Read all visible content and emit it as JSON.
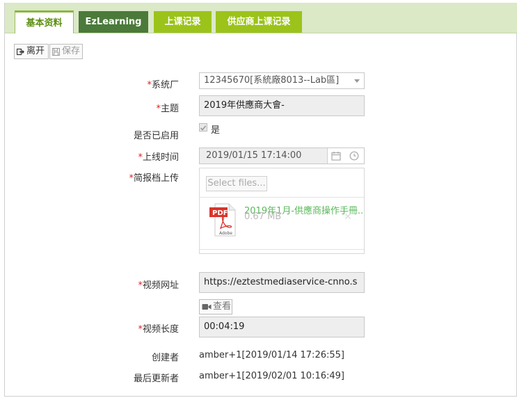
{
  "tabs": [
    "基本资料",
    "EzLearning",
    "上课记录",
    "供应商上课记录"
  ],
  "toolbar": {
    "leave_label": "离开",
    "save_label": "保存"
  },
  "form": {
    "required_mark": "*",
    "system_factory": {
      "label": "系统厂",
      "value": "12345670[系統廠8013--Lab區]"
    },
    "subject": {
      "label": "主题",
      "value": "2019年供應商大會-"
    },
    "enabled": {
      "label": "是否已启用",
      "option_label": "是",
      "checked": true
    },
    "online_time": {
      "label": "上线时间",
      "value": "2019/01/15 17:14:00"
    },
    "brief_upload": {
      "label": "简报档上传",
      "select_files_label": "Select files...",
      "file_name": "2019年1月-供應商操作手冊...",
      "file_size": "0.67 MB",
      "remove_glyph": "✕"
    },
    "video_url": {
      "label": "视频网址",
      "value": "https://eztestmediaservice-cnno.s"
    },
    "view_button_label": "查看",
    "video_length": {
      "label": "视频长度",
      "value": "00:04:19"
    },
    "creator": {
      "label": "创建者",
      "value": "amber+1[2019/01/14 17:26:55]"
    },
    "last_updater": {
      "label": "最后更新者",
      "value": "amber+1[2019/02/01 10:16:49]"
    }
  },
  "colors": {
    "accent_green": "#9bc31a",
    "dark_green": "#4b7a3a",
    "tab_bar": "#dbe9c7",
    "required": "#dd2222",
    "file_link": "#5cb85c"
  },
  "icons": [
    "exit-icon",
    "save-icon",
    "calendar-icon",
    "clock-icon",
    "pdf-file-icon",
    "video-camera-icon",
    "chevron-down-icon",
    "checkbox-icon"
  ]
}
